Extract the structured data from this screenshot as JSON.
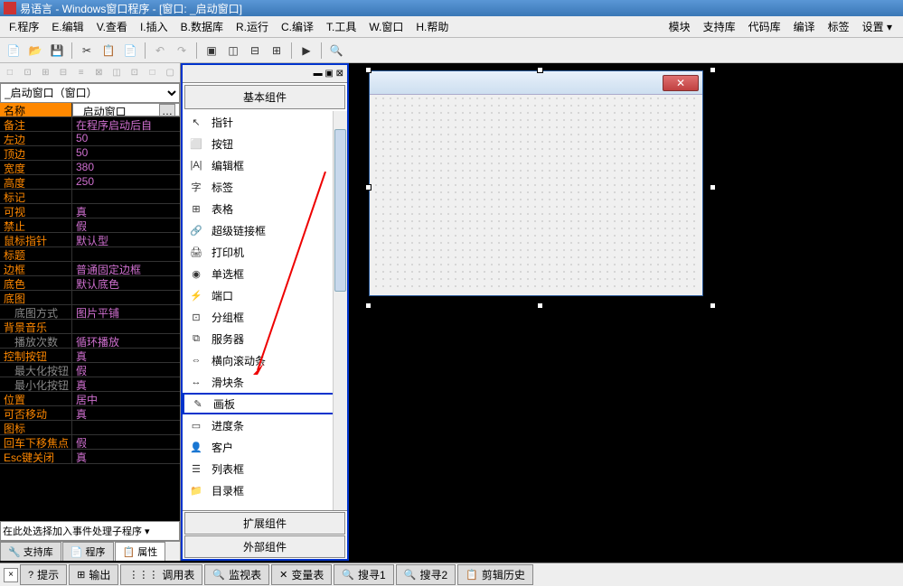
{
  "title": "易语言 - Windows窗口程序 - [窗口: _启动窗口]",
  "menubar": {
    "items": [
      "F.程序",
      "E.编辑",
      "V.查看",
      "I.插入",
      "B.数据库",
      "R.运行",
      "C.编译",
      "T.工具",
      "W.窗口",
      "H.帮助"
    ],
    "right_items": [
      "模块",
      "支持库",
      "代码库",
      "编译",
      "标签",
      "设置 ▾"
    ]
  },
  "left": {
    "combo": "_启动窗口（窗口）",
    "props": [
      {
        "key": "名称",
        "val": "_启动窗口",
        "sel": true
      },
      {
        "key": "备注",
        "val": "在程序启动后自"
      },
      {
        "key": "左边",
        "val": "50"
      },
      {
        "key": "顶边",
        "val": "50"
      },
      {
        "key": "宽度",
        "val": "380"
      },
      {
        "key": "高度",
        "val": "250"
      },
      {
        "key": "标记",
        "val": ""
      },
      {
        "key": "可视",
        "val": "真"
      },
      {
        "key": "禁止",
        "val": "假"
      },
      {
        "key": "鼠标指针",
        "val": "默认型"
      },
      {
        "key": "标题",
        "val": ""
      },
      {
        "key": "边框",
        "val": "普通固定边框"
      },
      {
        "key": "底色",
        "val": "默认底色"
      },
      {
        "key": "底图",
        "val": ""
      },
      {
        "key": "底图方式",
        "val": "图片平铺",
        "indent": true
      },
      {
        "key": "背景音乐",
        "val": ""
      },
      {
        "key": "播放次数",
        "val": "循环播放",
        "indent": true
      },
      {
        "key": "控制按钮",
        "val": "真"
      },
      {
        "key": "最大化按钮",
        "val": "假",
        "indent": true
      },
      {
        "key": "最小化按钮",
        "val": "真",
        "indent": true
      },
      {
        "key": "位置",
        "val": "居中"
      },
      {
        "key": "可否移动",
        "val": "真"
      },
      {
        "key": "图标",
        "val": ""
      },
      {
        "key": "回车下移焦点",
        "val": "假"
      },
      {
        "key": "Esc键关闭",
        "val": "真"
      }
    ],
    "event_hint": "在此处选择加入事件处理子程序 ▾",
    "tabs": [
      "🔧 支持库",
      "📄 程序",
      "📋 属性"
    ]
  },
  "mid": {
    "header": "基本组件",
    "items": [
      {
        "icon": "↖",
        "label": "指针"
      },
      {
        "icon": "⬜",
        "label": "按钮"
      },
      {
        "icon": "|A|",
        "label": "编辑框"
      },
      {
        "icon": "字",
        "label": "标签"
      },
      {
        "icon": "⊞",
        "label": "表格"
      },
      {
        "icon": "🔗",
        "label": "超级链接框"
      },
      {
        "icon": "🖨",
        "label": "打印机"
      },
      {
        "icon": "◉",
        "label": "单选框"
      },
      {
        "icon": "⚡",
        "label": "端口"
      },
      {
        "icon": "⊡",
        "label": "分组框"
      },
      {
        "icon": "⧉",
        "label": "服务器"
      },
      {
        "icon": "⇔",
        "label": "横向滚动条"
      },
      {
        "icon": "↔",
        "label": "滑块条"
      },
      {
        "icon": "✎",
        "label": "画板",
        "highlighted": true
      },
      {
        "icon": "▭",
        "label": "进度条"
      },
      {
        "icon": "👤",
        "label": "客户"
      },
      {
        "icon": "☰",
        "label": "列表框"
      },
      {
        "icon": "📁",
        "label": "目录框"
      }
    ],
    "bottom": [
      "扩展组件",
      "外部组件"
    ]
  },
  "bottom_tabs": [
    {
      "icon": "?",
      "label": "提示"
    },
    {
      "icon": "⊞",
      "label": "输出"
    },
    {
      "icon": "⋮⋮⋮",
      "label": "调用表"
    },
    {
      "icon": "🔍",
      "label": "监视表"
    },
    {
      "icon": "✕",
      "label": "变量表"
    },
    {
      "icon": "🔍",
      "label": "搜寻1"
    },
    {
      "icon": "🔍",
      "label": "搜寻2"
    },
    {
      "icon": "📋",
      "label": "剪辑历史"
    }
  ]
}
